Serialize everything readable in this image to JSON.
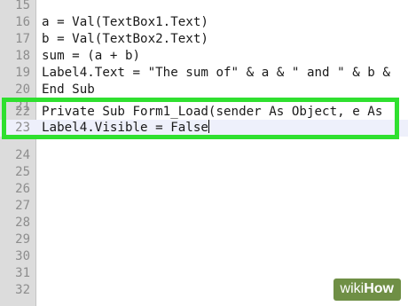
{
  "editor": {
    "lines": [
      {
        "num": "15",
        "text": ""
      },
      {
        "num": "16",
        "text": "a = Val(TextBox1.Text)"
      },
      {
        "num": "17",
        "text": "b = Val(TextBox2.Text)"
      },
      {
        "num": "18",
        "text": "sum = (a + b)"
      },
      {
        "num": "19",
        "text": "Label4.Text = \"The sum of\" & a & \" and \" & b &"
      },
      {
        "num": "20",
        "text": "End Sub"
      },
      {
        "num": "21",
        "text": ""
      },
      {
        "num": "22",
        "text": "Private Sub Form1_Load(sender As Object, e As"
      },
      {
        "num": "23",
        "text": "Label4.Visible = False"
      },
      {
        "num": "24",
        "text": ""
      },
      {
        "num": "25",
        "text": ""
      },
      {
        "num": "26",
        "text": ""
      },
      {
        "num": "27",
        "text": ""
      },
      {
        "num": "28",
        "text": ""
      },
      {
        "num": "29",
        "text": ""
      },
      {
        "num": "30",
        "text": ""
      },
      {
        "num": "31",
        "text": ""
      },
      {
        "num": "32",
        "text": ""
      }
    ]
  },
  "watermark": {
    "part1": "wiki",
    "part2": "How"
  },
  "colors": {
    "highlight_border": "#2fe02f",
    "gutter": "#dcdcdc",
    "active_line": "#eef0fb"
  }
}
